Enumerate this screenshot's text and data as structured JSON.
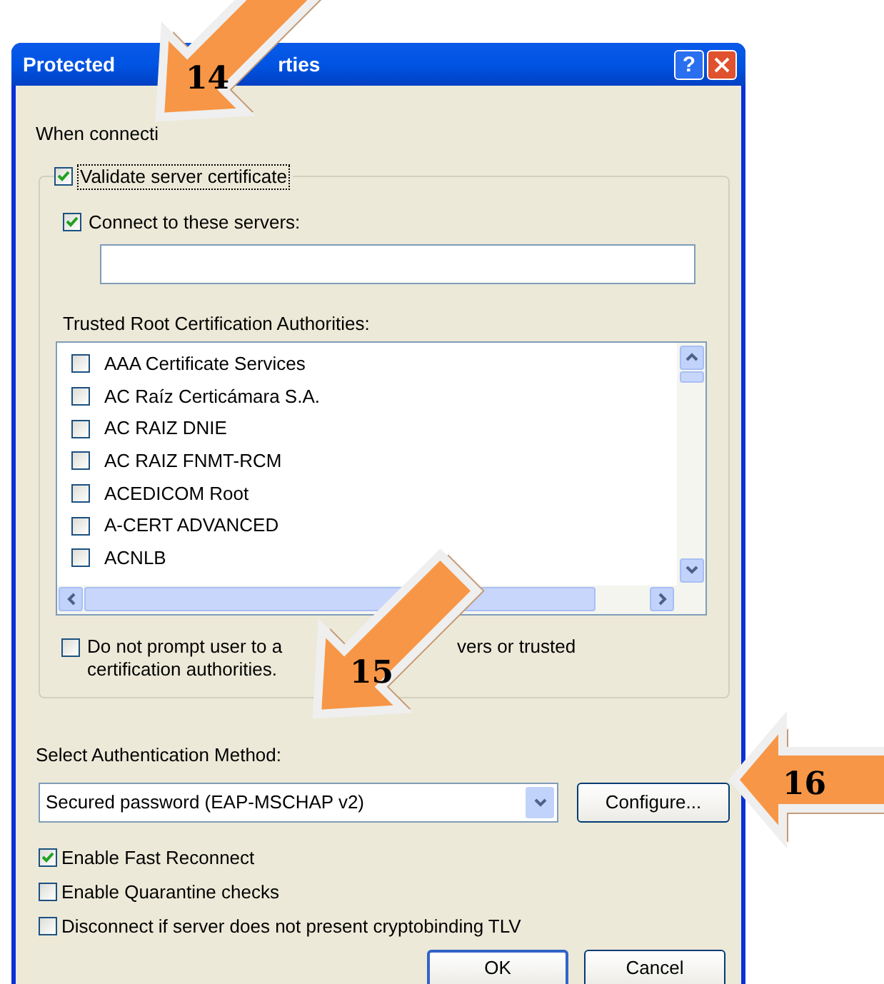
{
  "window": {
    "title_parts": [
      "Protected",
      "rties"
    ],
    "help": "?"
  },
  "intro": "When connecti",
  "validate": {
    "label": "Validate server certificate",
    "checked": true
  },
  "connect": {
    "label": "Connect to these servers:",
    "checked": true
  },
  "trusted_label": "Trusted Root Certification Authorities:",
  "authorities": [
    {
      "name": "AAA Certificate Services",
      "checked": false
    },
    {
      "name": "AC Raíz Certicámara S.A.",
      "checked": false
    },
    {
      "name": "AC RAIZ DNIE",
      "checked": false
    },
    {
      "name": "AC RAIZ FNMT-RCM",
      "checked": false
    },
    {
      "name": "ACEDICOM Root",
      "checked": false
    },
    {
      "name": "A-CERT ADVANCED",
      "checked": false
    },
    {
      "name": "ACNLB",
      "checked": false
    }
  ],
  "no_prompt": {
    "checked": false,
    "parts": [
      "Do not prompt user to a",
      "vers or trusted"
    ],
    "line2": "certification authorities."
  },
  "method_label": "Select Authentication Method:",
  "method": {
    "value": "Secured password (EAP-MSCHAP v2)"
  },
  "configure": "Configure...",
  "options": [
    {
      "label": "Enable Fast Reconnect",
      "checked": true
    },
    {
      "label": "Enable Quarantine checks",
      "checked": false
    },
    {
      "label": "Disconnect if server does not present cryptobinding TLV",
      "checked": false
    }
  ],
  "buttons": [
    "OK",
    "Cancel"
  ],
  "callouts": [
    {
      "label": "14"
    },
    {
      "label": "15"
    },
    {
      "label": "16"
    }
  ]
}
